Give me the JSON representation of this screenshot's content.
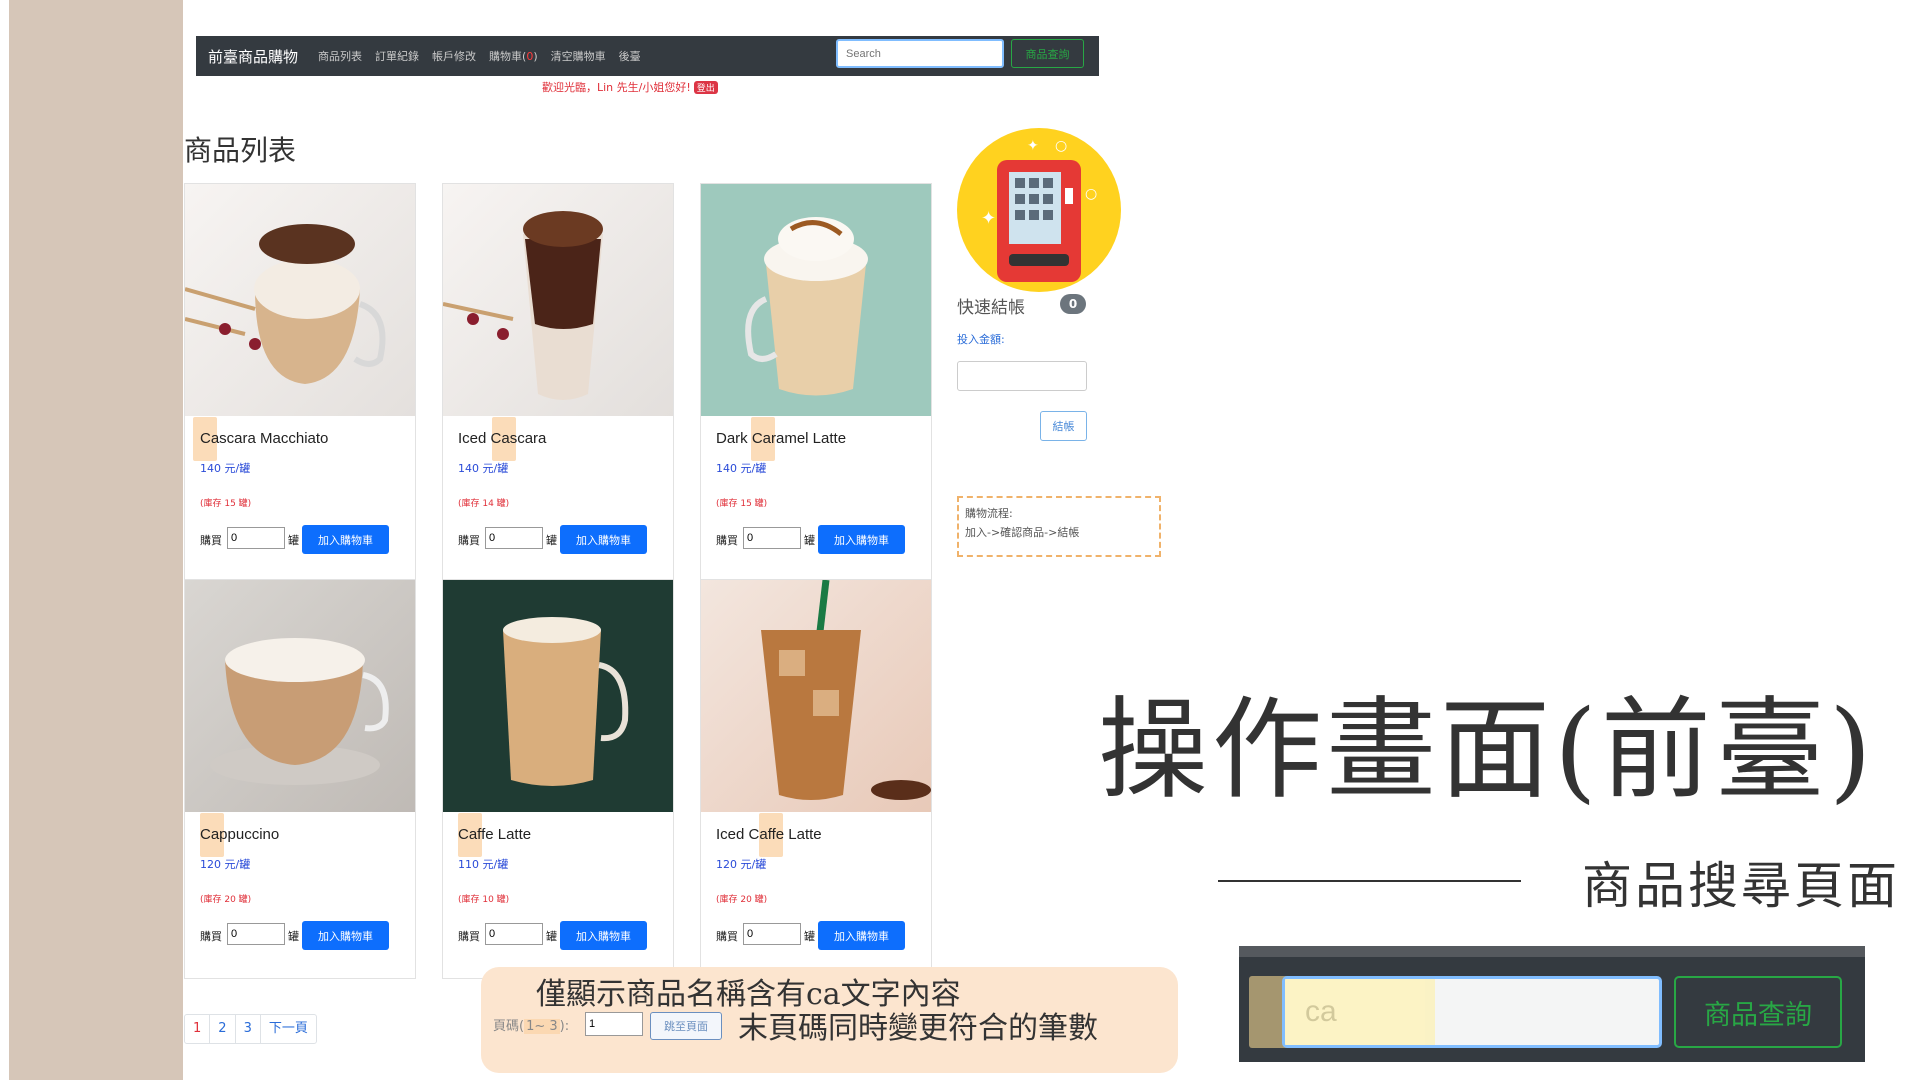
{
  "navbar": {
    "brand": "前臺商品購物",
    "links": [
      "商品列表",
      "訂單紀錄",
      "帳戶修改",
      "購物車",
      "清空購物車",
      "後臺"
    ],
    "cart_count": "0",
    "search_placeholder": "Search",
    "search_button": "商品查詢"
  },
  "welcome": {
    "text": "歡迎光臨，Lin 先生/小姐您好!",
    "logout": "登出"
  },
  "page_title": "商品列表",
  "products": [
    {
      "name": "Cascara Macchiato",
      "price": "140 元/罐",
      "stock": "(庫存 15 罐)",
      "qty": "0"
    },
    {
      "name": "Iced Cascara",
      "price": "140 元/罐",
      "stock": "(庫存 14 罐)",
      "qty": "0"
    },
    {
      "name": "Dark Caramel Latte",
      "price": "140 元/罐",
      "stock": "(庫存 15 罐)",
      "qty": "0"
    },
    {
      "name": "Cappuccino",
      "price": "120 元/罐",
      "stock": "(庫存 20 罐)",
      "qty": "0"
    },
    {
      "name": "Caffe Latte",
      "price": "110 元/罐",
      "stock": "(庫存 10 罐)",
      "qty": "0"
    },
    {
      "name": "Iced Caffe Latte",
      "price": "120 元/罐",
      "stock": "(庫存 20 罐)",
      "qty": "0"
    }
  ],
  "buy_label": "購買",
  "unit": "罐",
  "add_button": "加入購物車",
  "sidebar": {
    "quick_checkout": "快速結帳",
    "badge": "0",
    "insert_label": "投入金額:",
    "checkout_button": "結帳",
    "flow_title": "購物流程:",
    "flow_steps": "加入->確認商品->結帳"
  },
  "pagination": {
    "pages": [
      "1",
      "2",
      "3"
    ],
    "next": "下一頁",
    "info_prefix": "頁碼(",
    "info_range": "1~ 3",
    "info_suffix": "):",
    "page_value": "1",
    "jump_button": "跳至頁面"
  },
  "notes": {
    "line1": "僅顯示商品名稱含有ca文字內容",
    "line2": "末頁碼同時變更符合的筆數"
  },
  "title": "操作畫面(前臺)",
  "subtitle": "商品搜尋頁面",
  "zoom": {
    "search_value": "ca",
    "button": "商品查詢"
  },
  "colors": {
    "navbar": "#343a40",
    "primary": "#0d6efd",
    "success": "#28a745",
    "danger": "#dc3545",
    "highlight": "#fbdcb9",
    "sidebar_band": "#d6c6b8"
  }
}
